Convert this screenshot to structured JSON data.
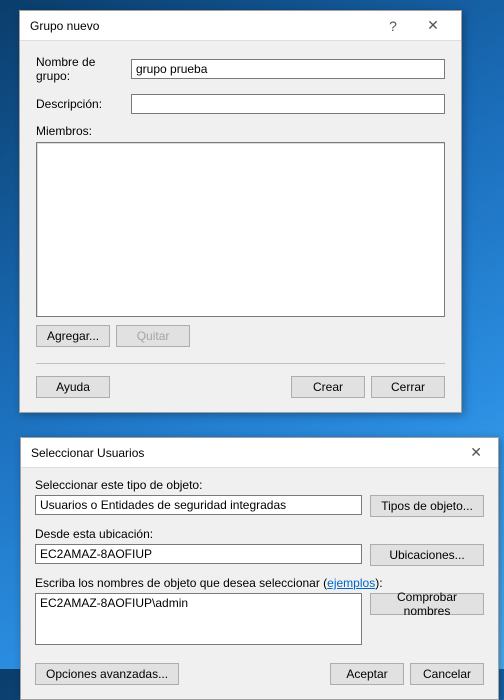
{
  "dialog1": {
    "title": "Grupo nuevo",
    "helpGlyph": "?",
    "closeGlyph": "✕",
    "groupNameLabel": "Nombre de grupo:",
    "groupNameValue": "grupo prueba",
    "descriptionLabel": "Descripción:",
    "descriptionValue": "",
    "membersLabel": "Miembros:",
    "addButton": "Agregar...",
    "removeButton": "Quitar",
    "helpButton": "Ayuda",
    "createButton": "Crear",
    "closeButton": "Cerrar"
  },
  "dialog2": {
    "title": "Seleccionar Usuarios",
    "closeGlyph": "✕",
    "objectTypeLabel": "Seleccionar este tipo de objeto:",
    "objectTypeValue": "Usuarios o Entidades de seguridad integradas",
    "objectTypeButton": "Tipos de objeto...",
    "locationLabel": "Desde esta ubicación:",
    "locationValue": "EC2AMAZ-8AOFIUP",
    "locationButton": "Ubicaciones...",
    "namesLabelPrefix": "Escriba los nombres de objeto que desea seleccionar (",
    "namesLink": "ejemplos",
    "namesLabelSuffix": "):",
    "namesValue": "EC2AMAZ-8AOFIUP\\admin",
    "checkNamesButton": "Comprobar nombres",
    "advancedButton": "Opciones avanzadas...",
    "okButton": "Aceptar",
    "cancelButton": "Cancelar"
  }
}
